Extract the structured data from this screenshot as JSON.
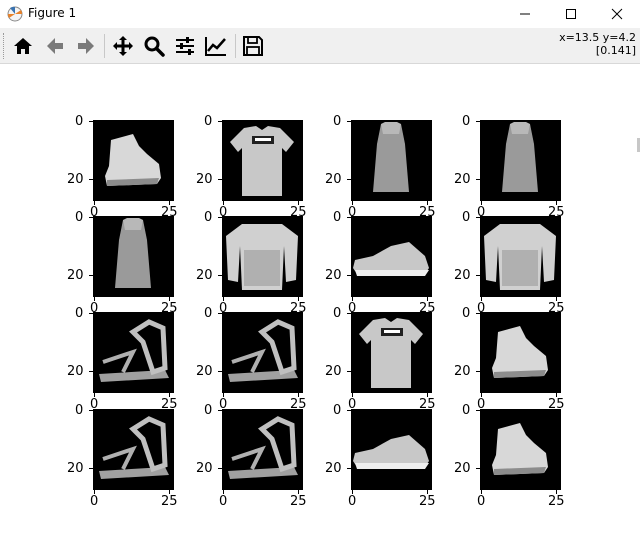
{
  "window": {
    "title": "Figure 1"
  },
  "toolbar": {
    "buttons": [
      {
        "name": "home",
        "icon": "home-icon"
      },
      {
        "name": "back",
        "icon": "arrow-left-icon"
      },
      {
        "name": "forward",
        "icon": "arrow-right-icon"
      },
      {
        "name": "pan",
        "icon": "move-icon"
      },
      {
        "name": "zoom",
        "icon": "search-icon"
      },
      {
        "name": "subplots",
        "icon": "sliders-icon"
      },
      {
        "name": "customize",
        "icon": "line-chart-icon"
      },
      {
        "name": "save",
        "icon": "save-icon"
      }
    ],
    "status_line1": "x=13.5 y=4.2",
    "status_line2": "[0.141]"
  },
  "figure": {
    "rows": 4,
    "cols": 4,
    "y_ticks": [
      "0",
      "20"
    ],
    "x_ticks": [
      "0",
      "25"
    ],
    "images": [
      "ankle boot",
      "t-shirt",
      "dress",
      "dress",
      "dress",
      "pullover",
      "sneaker",
      "pullover",
      "sandal",
      "sandal",
      "t-shirt",
      "ankle boot",
      "sandal",
      "sandal",
      "sneaker",
      "ankle boot"
    ]
  }
}
